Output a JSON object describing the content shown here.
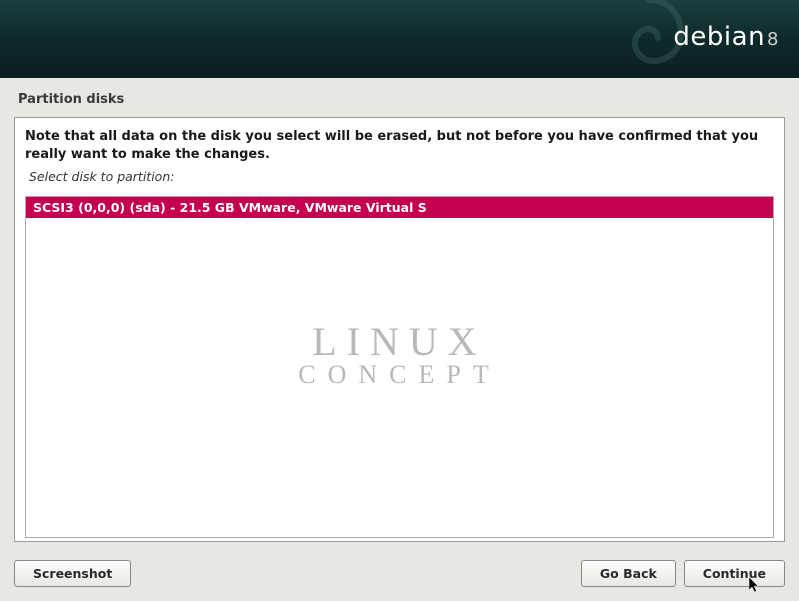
{
  "header": {
    "brand": "debian",
    "version": "8"
  },
  "page": {
    "title": "Partition disks",
    "warning": "Note that all data on the disk you select will be erased, but not before you have confirmed that you really want to make the changes.",
    "instruction": "Select disk to partition:"
  },
  "disks": [
    {
      "label": "SCSI3 (0,0,0) (sda) - 21.5 GB VMware, VMware Virtual S",
      "selected": true
    }
  ],
  "watermark": {
    "line1": "LINUX",
    "line2": "CONCEPT"
  },
  "buttons": {
    "screenshot": "Screenshot",
    "go_back": "Go Back",
    "continue": "Continue"
  }
}
